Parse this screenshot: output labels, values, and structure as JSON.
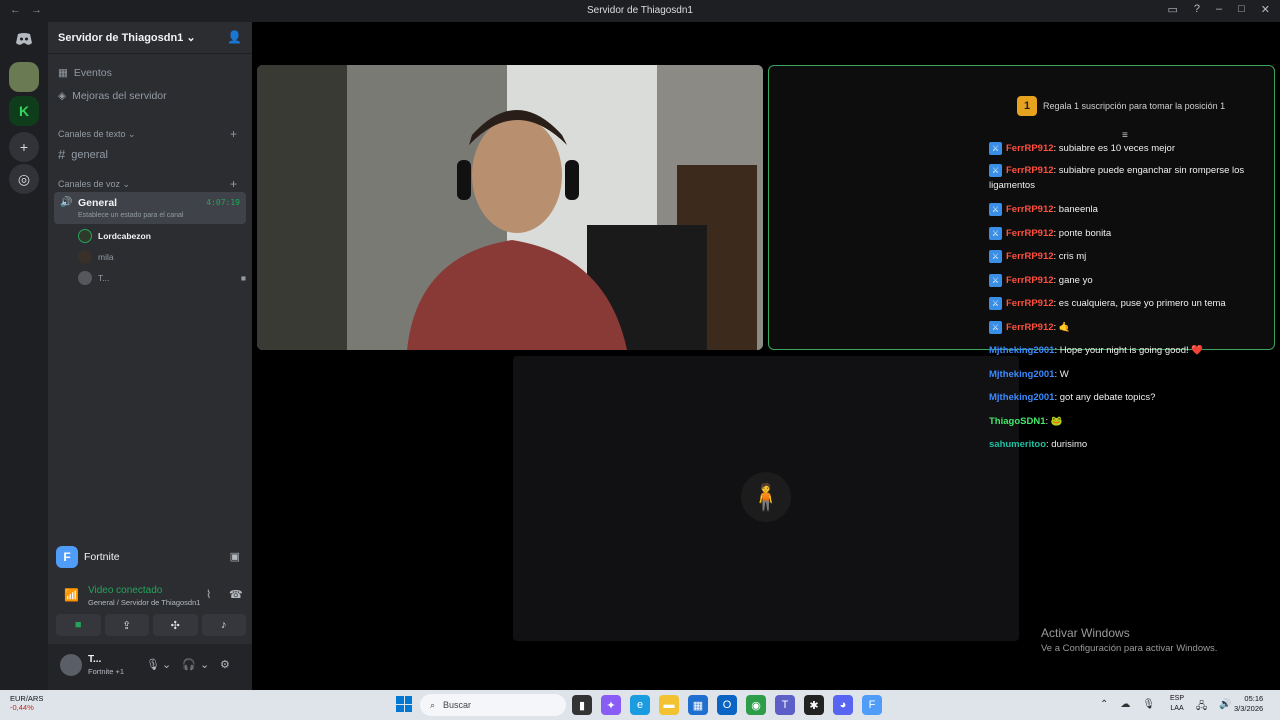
{
  "window": {
    "title": "Servidor de Thiagosdn1",
    "back": "←",
    "forward": "→"
  },
  "sidebar": {
    "server_name": "Servidor de Thiagosdn1",
    "items": [
      {
        "label": "Eventos",
        "icon": "calendar-icon"
      },
      {
        "label": "Mejoras del servidor",
        "icon": "boost-icon"
      }
    ],
    "text_category": "Canales de texto",
    "text_channels": [
      {
        "label": "general",
        "icon": "hashtag-icon"
      }
    ],
    "voice_category": "Canales de voz",
    "voice_channel": {
      "name": "General",
      "timer": "4:07:19",
      "status": "Establece un estado para el canal"
    },
    "members": [
      {
        "name": "Lordcabezon"
      },
      {
        "name": "mila"
      },
      {
        "name": "T..."
      }
    ]
  },
  "activity": {
    "game": "Fortnite"
  },
  "voice_connection": {
    "status": "Video conectado",
    "location": "General / Servidor de Thiagosdn1"
  },
  "user": {
    "name": "T...",
    "status": "Fortnite +1"
  },
  "chat": {
    "gift_rank": "1",
    "gift_text": "Regala 1 suscripción para tomar la posición 1",
    "messages": [
      {
        "user": "FerrRP912",
        "text": ": subiabre es 10 veces mejor",
        "color": "#ff4f3f",
        "mod": true
      },
      {
        "user": "FerrRP912",
        "text": ": subiabre puede enganchar sin romperse los ligamentos",
        "color": "#ff4f3f",
        "mod": true
      },
      {
        "user": "FerrRP912",
        "text": ": baneenla",
        "color": "#ff4f3f",
        "mod": true
      },
      {
        "user": "FerrRP912",
        "text": ": ponte bonita",
        "color": "#ff4f3f",
        "mod": true
      },
      {
        "user": "FerrRP912",
        "text": ": cris mj",
        "color": "#ff4f3f",
        "mod": true
      },
      {
        "user": "FerrRP912",
        "text": ": gane yo",
        "color": "#ff4f3f",
        "mod": true
      },
      {
        "user": "FerrRP912",
        "text": ": es cualquiera, puse yo primero un tema",
        "color": "#ff4f3f",
        "mod": true
      },
      {
        "user": "FerrRP912",
        "text": ": 🤙",
        "color": "#ff4f3f",
        "mod": true
      },
      {
        "user": "Mjtheking2001",
        "text": ": Hope your night is going good! ❤️",
        "color": "#3b8bff",
        "mod": false
      },
      {
        "user": "Mjtheking2001",
        "text": ": W",
        "color": "#3b8bff",
        "mod": false
      },
      {
        "user": "Mjtheking2001",
        "text": ": got any debate topics?",
        "color": "#3b8bff",
        "mod": false
      },
      {
        "user": "ThiagoSDN1",
        "text": ": 🐸",
        "color": "#41e86a",
        "mod": false
      },
      {
        "user": "sahumeritoo",
        "text": ": durisimo",
        "color": "#1fbfa0",
        "mod": false
      }
    ]
  },
  "windows_watermark": {
    "line1": "Activar Windows",
    "line2": "Ve a Configuración para activar Windows."
  },
  "taskbar": {
    "ticker": "EUR/ARS",
    "ticker_change": "-0,44%",
    "search_placeholder": "Buscar",
    "lang_line1": "ESP",
    "lang_line2": "LAA",
    "time": "05:16",
    "date": "3/3/2026"
  },
  "colors": {
    "accent_green": "#23a55a",
    "sidebar_bg": "#2b2d31",
    "rail_bg": "#1e1f22",
    "stream_border": "#3ba55d"
  }
}
